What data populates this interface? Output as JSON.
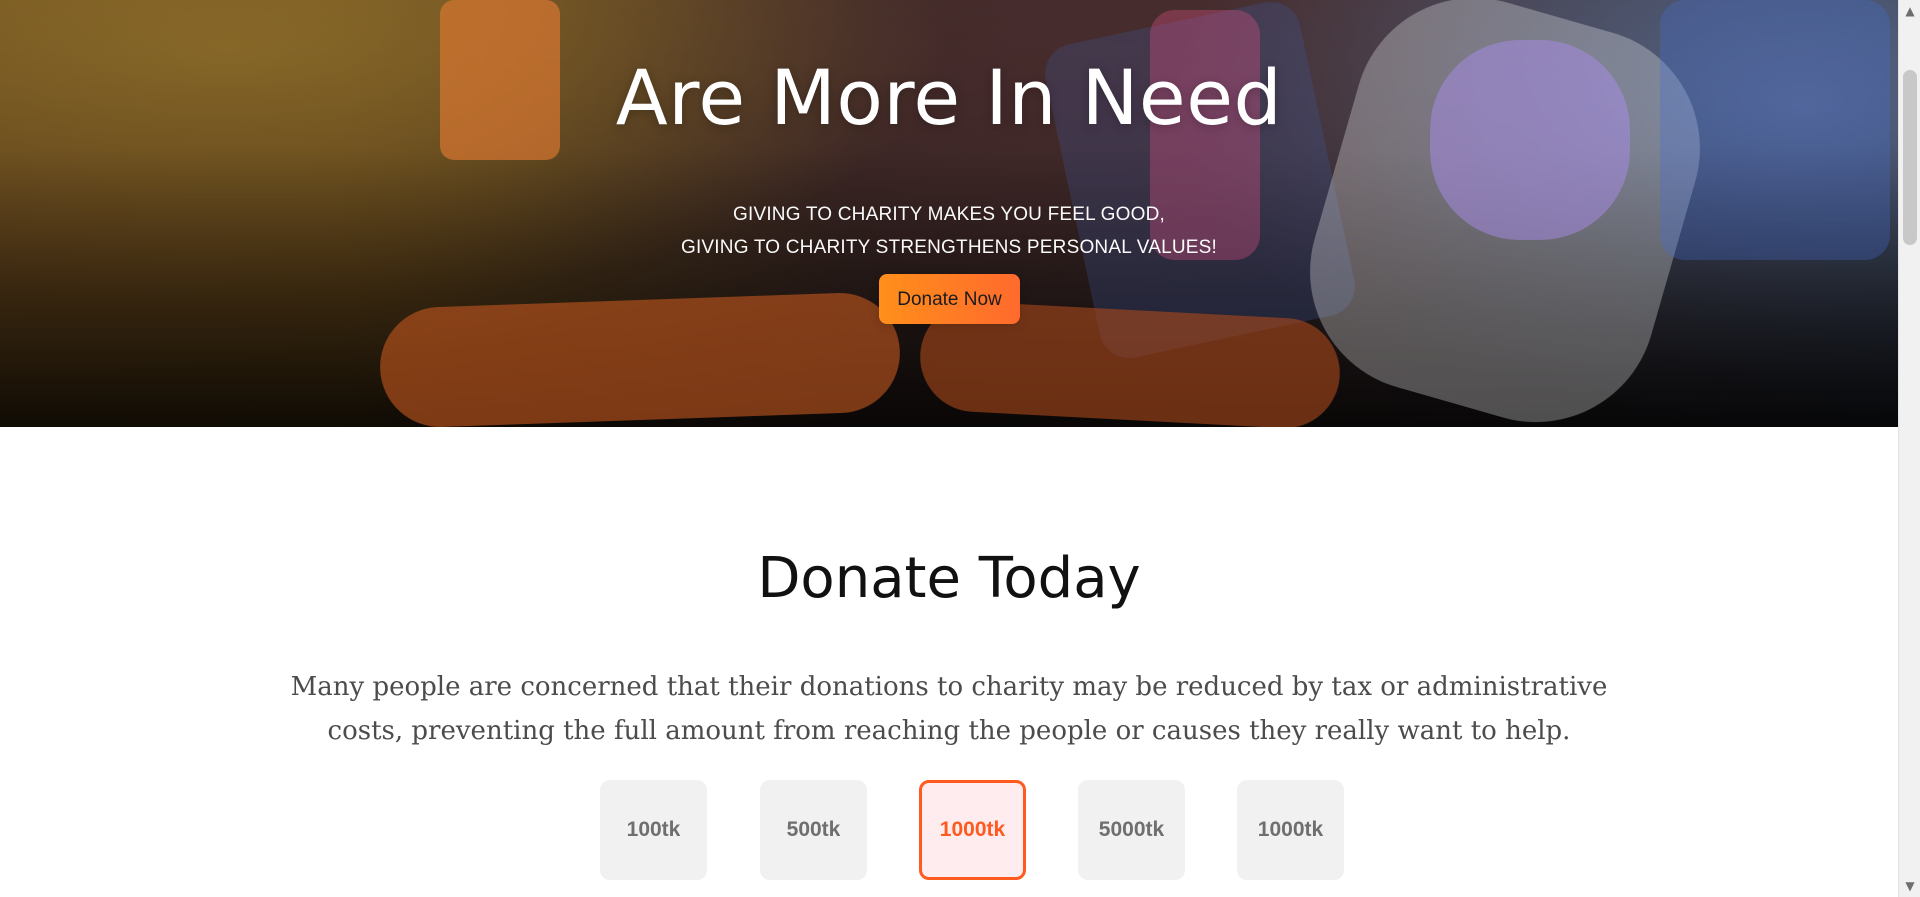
{
  "hero": {
    "title": "Are More In Need",
    "subtitle_lines": [
      "GIVING TO CHARITY MAKES YOU FEEL GOOD,",
      "GIVING TO CHARITY STRENGTHENS PERSONAL VALUES!"
    ],
    "cta_label": "Donate Now"
  },
  "donate": {
    "title": "Donate Today",
    "description": "Many people are concerned that their donations to charity may be reduced by tax or administrative costs, preventing the full amount from reaching the people or causes they really want to help.",
    "amounts": [
      "100tk",
      "500tk",
      "1000tk",
      "5000tk",
      "1000tk"
    ],
    "selected_index": 2
  },
  "colors": {
    "accent_orange": "#ff5a1f",
    "button_gradient_start": "#ff8f1b",
    "button_gradient_end": "#ff6a2d"
  },
  "icons": {
    "scroll_up": "chevron-up-icon",
    "scroll_down": "chevron-down-icon"
  }
}
